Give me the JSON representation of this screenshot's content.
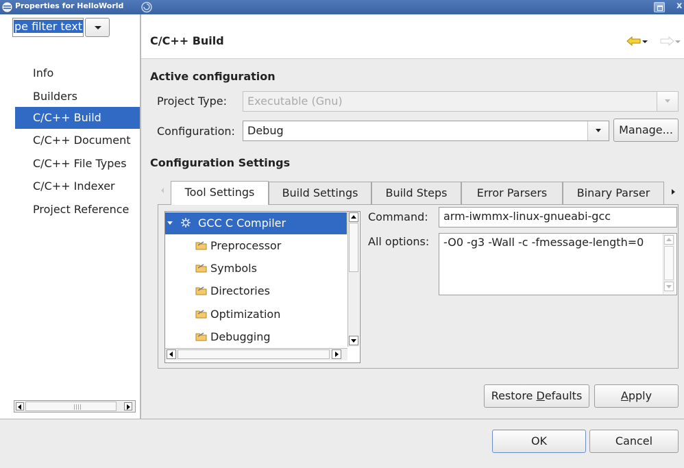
{
  "window": {
    "title": "Properties for HelloWorld"
  },
  "filter": {
    "text": "pe filter text"
  },
  "nav": {
    "items": [
      {
        "label": "Info"
      },
      {
        "label": "Builders"
      },
      {
        "label": "C/C++ Build",
        "selected": true
      },
      {
        "label": "C/C++ Document"
      },
      {
        "label": "C/C++ File Types"
      },
      {
        "label": "C/C++ Indexer"
      },
      {
        "label": "Project Reference"
      }
    ]
  },
  "page": {
    "title": "C/C++ Build"
  },
  "active_config": {
    "heading": "Active configuration",
    "project_type_label": "Project Type:",
    "project_type_value": "Executable (Gnu)",
    "configuration_label": "Configuration:",
    "configuration_value": "Debug",
    "manage_label": "Manage..."
  },
  "config_settings": {
    "heading": "Configuration Settings",
    "tabs": [
      {
        "label": "Tool Settings",
        "active": true
      },
      {
        "label": "Build Settings"
      },
      {
        "label": "Build Steps"
      },
      {
        "label": "Error Parsers"
      },
      {
        "label": "Binary Parser"
      }
    ]
  },
  "tool_tree": {
    "root": "GCC C Compiler",
    "children": [
      "Preprocessor",
      "Symbols",
      "Directories",
      "Optimization",
      "Debugging"
    ]
  },
  "tool_settings": {
    "command_label": "Command:",
    "command_value": "arm-iwmmx-linux-gnueabi-gcc",
    "all_options_label": "All options:",
    "all_options_value": "-O0 -g3 -Wall -c -fmessage-length=0"
  },
  "buttons": {
    "restore_prefix": "Restore ",
    "restore_mnemonic": "D",
    "restore_suffix": "efaults",
    "apply_mnemonic": "A",
    "apply_suffix": "pply",
    "ok": "OK",
    "cancel": "Cancel"
  },
  "colors": {
    "selection": "#316ac5",
    "titlebar": "#3a63a4"
  }
}
